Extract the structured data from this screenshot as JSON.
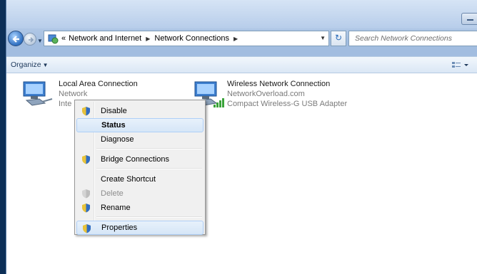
{
  "address_bar": {
    "overflow_chevron": "«",
    "breadcrumbs": [
      "Network and Internet",
      "Network Connections"
    ]
  },
  "search": {
    "placeholder": "Search Network Connections"
  },
  "command_bar": {
    "organize_label": "Organize"
  },
  "connections": [
    {
      "name": "Local Area Connection",
      "status": "Network",
      "adapter": "Inte"
    },
    {
      "name": "Wireless Network Connection",
      "status": "NetworkOverload.com",
      "adapter": "Compact Wireless-G USB Adapter"
    }
  ],
  "context_menu": {
    "items": [
      {
        "label": "Disable",
        "shield": true
      },
      {
        "label": "Status",
        "highlighted": true,
        "bold": true
      },
      {
        "label": "Diagnose"
      },
      {
        "label": "Bridge Connections",
        "shield": true
      },
      {
        "label": "Create Shortcut"
      },
      {
        "label": "Delete",
        "shield": true,
        "disabled": true
      },
      {
        "label": "Rename",
        "shield": true
      },
      {
        "label": "Properties",
        "shield": true,
        "highlighted": true
      }
    ]
  }
}
